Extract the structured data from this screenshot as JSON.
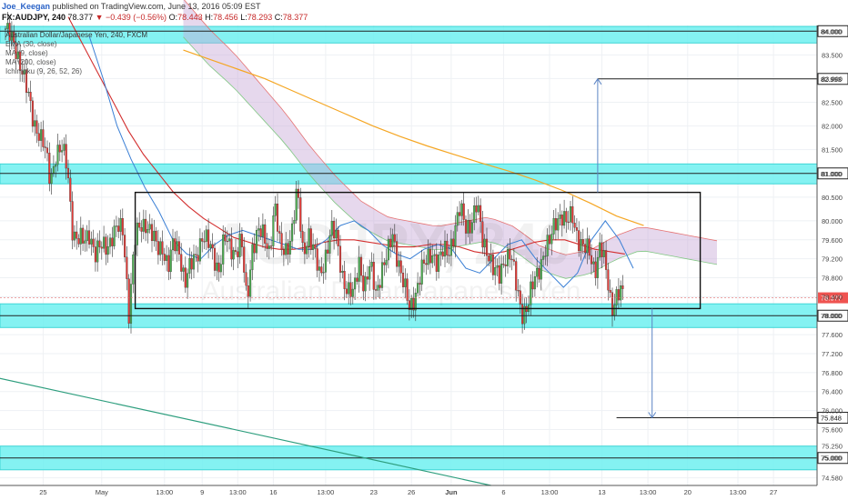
{
  "header": {
    "author": "Joe_Keegan",
    "published_text": "published on TradingView.com, June 13, 2016 05:09 EST",
    "symbol": "FX:AUDJPY, 240",
    "last": "78.377",
    "change": "▼ −0.439 (−0.56%)",
    "ohlc": {
      "o_label": "O:",
      "o": "78.443",
      "h_label": "H:",
      "h": "78.456",
      "l_label": "L:",
      "l": "78.293",
      "c_label": "C:",
      "c": "78.377"
    }
  },
  "legend": {
    "title": "Australian Dollar/Japanese Yen, 240, FXCM",
    "items": [
      "EMA (30, close)",
      "MA (9, close)",
      "MA (200, close)",
      "Ichimoku (9, 26, 52, 26)"
    ]
  },
  "watermark": {
    "symbol": "AUDJPY, 240",
    "name": "Australian Dollar/Japanese Yen"
  },
  "colors": {
    "bull": "#4caf50",
    "bear": "#e53935",
    "zone": "#6ff0f0",
    "zone_border": "#3fd6d6",
    "ema30": "#d32f2f",
    "ma9": "#3a7fd5",
    "ma200": "#f5a623",
    "cloud": "#c8a8d8",
    "trend": "#2e9e7e",
    "arrow": "#5b84c4"
  },
  "chart_data": {
    "type": "candlestick",
    "ylim": [
      74.42,
      84.12
    ],
    "y_ticks": [
      "84.000",
      "83.500",
      "83.000",
      "82.500",
      "82.000",
      "81.500",
      "81.000",
      "80.500",
      "80.000",
      "79.600",
      "79.200",
      "78.800",
      "78.400",
      "78.000",
      "77.600",
      "77.200",
      "76.800",
      "76.400",
      "76.000",
      "75.600",
      "75.250",
      "75.000",
      "74.580"
    ],
    "y_tick_values": [
      84.0,
      83.5,
      83.0,
      82.5,
      82.0,
      81.5,
      81.0,
      80.5,
      80.0,
      79.6,
      79.2,
      78.8,
      78.4,
      78.0,
      77.6,
      77.2,
      76.8,
      76.4,
      76.0,
      75.6,
      75.25,
      75.0,
      74.58
    ],
    "x_ticks": [
      "20",
      "25",
      "May",
      "13:00",
      "9",
      "13:00",
      "16",
      "13:00",
      "23",
      "26",
      "Jun",
      "6",
      "13:00",
      "13",
      "13:00",
      "20",
      "13:00",
      "27"
    ],
    "x_tick_bars": [
      -13,
      18,
      46,
      76,
      94,
      111,
      128,
      153,
      176,
      194,
      213,
      238,
      260,
      285,
      307,
      326,
      350,
      367
    ],
    "last_price_label": "78.377",
    "last_price": 78.377,
    "horizontal_levels": [
      84.0,
      81.0,
      78.0,
      75.848,
      75.0,
      82.993
    ],
    "level_labels": [
      "84.000",
      "81.000",
      "78.000",
      "75.848",
      "75.000",
      "82.993"
    ],
    "support_resistance_zones": [
      [
        83.75,
        84.1
      ],
      [
        80.78,
        81.2
      ],
      [
        77.75,
        78.25
      ],
      [
        74.75,
        75.25
      ]
    ],
    "range_box": {
      "start_bar": 62,
      "end_bar": 332,
      "high": 80.6,
      "low": 78.15
    },
    "projection_up": {
      "bar": 283,
      "from": 80.6,
      "to": 82.993
    },
    "projection_down": {
      "bar": 309,
      "from": 78.15,
      "to": 75.848
    },
    "trendline": {
      "bar_start": -5,
      "price_start": 76.7,
      "bar_end": 232,
      "price_end": 74.42
    },
    "candle_count": 296,
    "series": [
      {
        "name": "Price",
        "values": [
          84.05,
          83.8,
          83.6,
          83.2,
          82.6,
          82.1,
          81.9,
          81.5,
          80.8,
          81.5,
          81.5,
          81.1,
          79.8,
          79.6,
          79.5,
          79.8,
          79.3,
          79.4,
          79.5,
          79.7,
          79.8,
          79.8,
          78.1,
          79.5,
          79.9,
          80.0,
          79.7,
          79.4,
          79.5,
          79.0,
          79.5,
          79.4,
          78.7,
          79.0,
          79.3,
          79.7,
          79.5,
          79.3,
          79.0,
          79.6,
          79.4,
          79.4,
          79.6,
          78.2,
          79.5,
          79.8,
          79.6,
          79.4,
          80.4,
          79.3,
          79.4,
          79.8,
          80.6,
          79.3,
          79.8,
          79.3,
          78.8,
          79.3,
          79.8,
          79.6,
          78.9,
          78.5,
          78.4,
          79.2,
          78.6,
          79.0,
          78.5,
          79.0,
          79.2,
          79.7,
          79.2,
          78.6,
          78.1,
          78.5,
          78.9,
          79.1,
          79.4,
          79.1,
          79.3,
          79.4,
          79.8,
          80.2,
          79.9,
          80.0,
          80.3,
          79.6,
          79.4,
          78.9,
          78.8,
          79.3,
          79.3,
          78.6,
          78.1,
          78.2,
          78.6,
          79.0,
          79.4,
          79.5,
          80.0,
          80.2,
          79.9,
          80.1,
          79.7,
          79.4,
          79.3,
          79.0,
          79.5,
          78.9,
          78.2,
          78.5,
          78.4
        ]
      },
      {
        "name": "EMA (30, close)",
        "values": [
          84.3,
          83.7,
          83.1,
          82.5,
          81.9,
          81.4,
          81.0,
          80.6,
          80.3,
          80.05,
          79.85,
          79.65,
          79.55,
          79.45,
          79.4,
          79.4,
          79.45,
          79.55,
          79.6,
          79.6,
          79.55,
          79.5,
          79.45,
          79.45,
          79.5,
          79.5,
          79.45,
          79.35,
          79.3,
          79.35,
          79.45,
          79.55,
          79.6,
          79.6,
          79.5,
          79.4,
          79.35,
          79.3
        ]
      },
      {
        "name": "MA (9, close)",
        "values": [
          83.9,
          83.0,
          82.0,
          81.3,
          80.7,
          80.2,
          79.6,
          79.3,
          79.2,
          79.5,
          79.7,
          79.8,
          79.7,
          79.6,
          79.5,
          79.4,
          79.4,
          79.6,
          79.9,
          80.0,
          79.8,
          79.5,
          79.3,
          79.2,
          79.4,
          79.5,
          79.4,
          79.0,
          78.9,
          79.2,
          79.5,
          79.6,
          79.2,
          78.9,
          78.6,
          78.9,
          79.6,
          80.0,
          79.6,
          79.0
        ]
      },
      {
        "name": "MA (200, close)",
        "values": [
          83.6,
          83.4,
          83.2,
          83.0,
          82.75,
          82.5,
          82.25,
          82.0,
          81.78,
          81.58,
          81.4,
          81.22,
          81.05,
          80.86,
          80.64,
          80.38,
          80.1,
          79.9
        ]
      },
      {
        "name": "Ichimoku (9, 26, 52, 26)",
        "values": [
          84.2,
          83.6,
          83.1,
          82.5,
          81.9,
          81.2,
          80.6,
          80.1,
          79.8,
          79.7,
          79.6,
          79.7,
          79.8,
          79.6,
          79.2,
          79.0,
          79.1,
          79.4,
          79.6,
          79.5,
          79.4,
          79.3
        ]
      }
    ]
  }
}
